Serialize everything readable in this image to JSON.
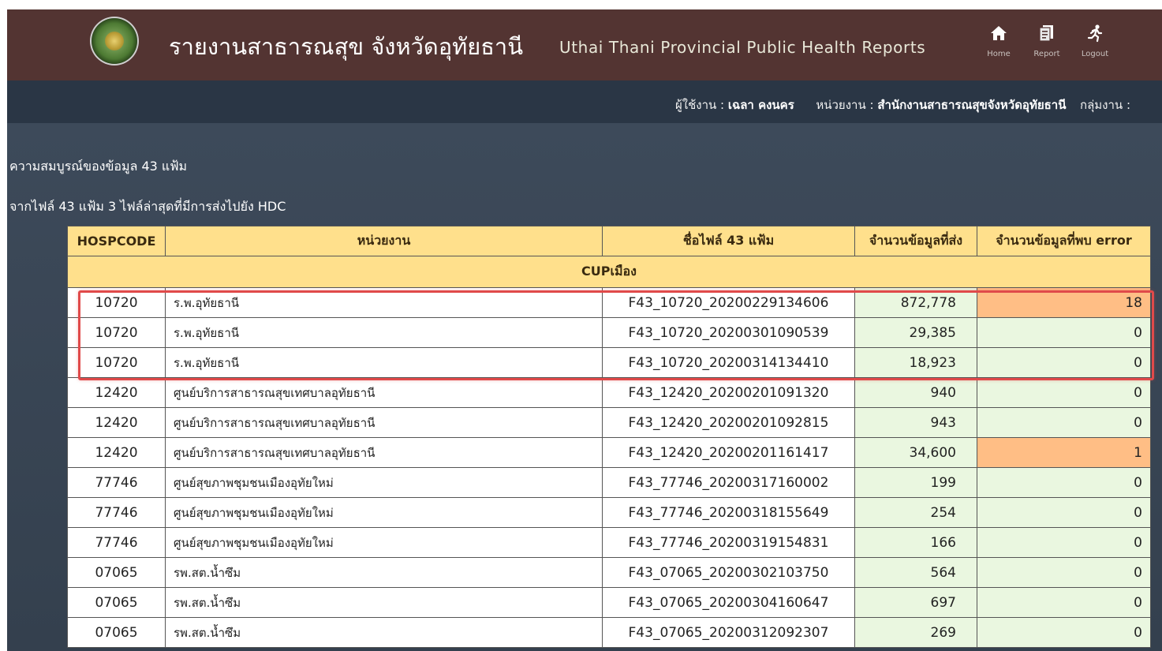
{
  "header": {
    "title_th": "รายงานสาธารณสุข จังหวัดอุทัยธานี",
    "title_en": "Uthai Thani Provincial Public Health Reports",
    "nav": [
      {
        "label": "Home",
        "icon": "home-icon"
      },
      {
        "label": "Report",
        "icon": "report-icon"
      },
      {
        "label": "Logout",
        "icon": "logout-icon"
      }
    ]
  },
  "userbar": {
    "user_label": "ผู้ใช้งาน :",
    "user_name": "เฉลา คงนคร",
    "unit_label": "หน่วยงาน :",
    "unit_name": "สำนักงานสาธารณสุขจังหวัดอุทัยธานี",
    "group_label": "กลุ่มงาน :"
  },
  "page": {
    "subtitle1": "ความสมบูรณ์ของข้อมูล 43 แฟ้ม",
    "subtitle2": "จากไฟล์ 43 แฟ้ม 3 ไฟล์ล่าสุดที่มีการส่งไปยัง HDC"
  },
  "table": {
    "headers": [
      "HOSPCODE",
      "หน่วยงาน",
      "ชื่อไฟล์ 43 แฟ้ม",
      "จำนวนข้อมูลที่ส่ง",
      "จำนวนข้อมูลที่พบ error"
    ],
    "group": "CUPเมือง",
    "rows": [
      {
        "code": "10720",
        "unit": "ร.พ.อุทัยธานี",
        "file": "F43_10720_20200229134606",
        "sent": "872,778",
        "error": "18"
      },
      {
        "code": "10720",
        "unit": "ร.พ.อุทัยธานี",
        "file": "F43_10720_20200301090539",
        "sent": "29,385",
        "error": "0"
      },
      {
        "code": "10720",
        "unit": "ร.พ.อุทัยธานี",
        "file": "F43_10720_20200314134410",
        "sent": "18,923",
        "error": "0"
      },
      {
        "code": "12420",
        "unit": "ศูนย์บริการสาธารณสุขเทศบาลอุทัยธานี",
        "file": "F43_12420_20200201091320",
        "sent": "940",
        "error": "0"
      },
      {
        "code": "12420",
        "unit": "ศูนย์บริการสาธารณสุขเทศบาลอุทัยธานี",
        "file": "F43_12420_20200201092815",
        "sent": "943",
        "error": "0"
      },
      {
        "code": "12420",
        "unit": "ศูนย์บริการสาธารณสุขเทศบาลอุทัยธานี",
        "file": "F43_12420_20200201161417",
        "sent": "34,600",
        "error": "1"
      },
      {
        "code": "77746",
        "unit": "ศูนย์สุขภาพชุมชนเมืองอุทัยใหม่",
        "file": "F43_77746_20200317160002",
        "sent": "199",
        "error": "0"
      },
      {
        "code": "77746",
        "unit": "ศูนย์สุขภาพชุมชนเมืองอุทัยใหม่",
        "file": "F43_77746_20200318155649",
        "sent": "254",
        "error": "0"
      },
      {
        "code": "77746",
        "unit": "ศูนย์สุขภาพชุมชนเมืองอุทัยใหม่",
        "file": "F43_77746_20200319154831",
        "sent": "166",
        "error": "0"
      },
      {
        "code": "07065",
        "unit": "รพ.สต.น้ำซึม",
        "file": "F43_07065_20200302103750",
        "sent": "564",
        "error": "0"
      },
      {
        "code": "07065",
        "unit": "รพ.สต.น้ำซึม",
        "file": "F43_07065_20200304160647",
        "sent": "697",
        "error": "0"
      },
      {
        "code": "07065",
        "unit": "รพ.สต.น้ำซึม",
        "file": "F43_07065_20200312092307",
        "sent": "269",
        "error": "0"
      }
    ]
  },
  "colors": {
    "header_bg": "#533432",
    "table_header_bg": "#ffe08c",
    "ok_cell_bg": "#eaf7e0",
    "error_cell_bg": "#ffbe85",
    "highlight_border": "#e04a4a"
  }
}
